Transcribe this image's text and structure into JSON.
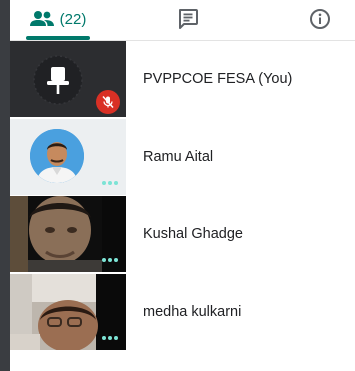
{
  "tabs": {
    "people_count": "(22)",
    "people_icon": "people-icon",
    "chat_icon": "chat-icon",
    "info_icon": "info-icon",
    "active": "people"
  },
  "participants": [
    {
      "name": "PVPPCOE FESA (You)",
      "tile": "pin-icon",
      "muted": true
    },
    {
      "name": "Ramu Aital",
      "tile": "avatar"
    },
    {
      "name": "Kushal Ghadge",
      "tile": "video"
    },
    {
      "name": "medha kulkarni",
      "tile": "video"
    }
  ],
  "colors": {
    "accent": "#00796b",
    "muted_badge": "#d93025",
    "dots": "#7de3d5",
    "tile_dark": "#2c2d30"
  }
}
